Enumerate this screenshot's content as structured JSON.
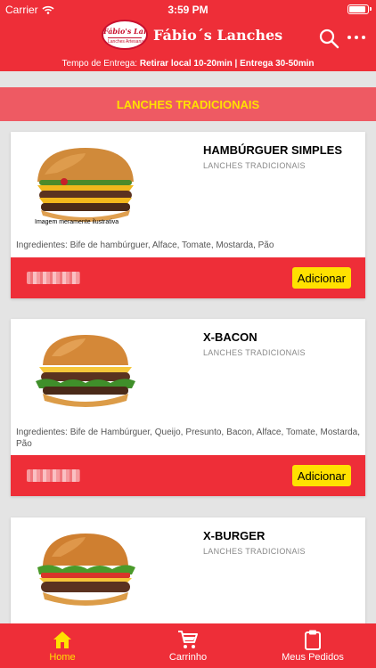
{
  "status_bar": {
    "carrier": "Carrier",
    "time": "3:59 PM",
    "battery_level": 0.95
  },
  "header": {
    "logo_line1": "Fábio's Lanches",
    "logo_line2": "Lanches Artesanais",
    "brand_name": "Fábio´s Lanches",
    "delivery_prefix": "Tempo de Entrega: ",
    "delivery_info": "Retirar local 10-20min | Entrega 30-50min"
  },
  "category_title": "LANCHES TRADICIONAIS",
  "products": [
    {
      "name": "HAMBÚRGUER SIMPLES",
      "category": "LANCHES TRADICIONAIS",
      "image_caption": "Imagem meramente ilustrativa",
      "ingredients": "Ingredientes: Bife de hambúrguer, Alface, Tomate, Mostarda, Pão",
      "add_label": "Adicionar"
    },
    {
      "name": "X-BACON",
      "category": "LANCHES TRADICIONAIS",
      "ingredients": "Ingredientes: Bife de Hambúrguer, Queijo, Presunto, Bacon, Alface, Tomate, Mostarda, Pão",
      "add_label": "Adicionar"
    },
    {
      "name": "X-BURGER",
      "category": "LANCHES TRADICIONAIS"
    }
  ],
  "tabbar": {
    "items": [
      {
        "label": "Home",
        "icon": "home-icon",
        "active": true
      },
      {
        "label": "Carrinho",
        "icon": "cart-icon",
        "active": false
      },
      {
        "label": "Meus Pedidos",
        "icon": "clipboard-icon",
        "active": false
      }
    ]
  },
  "colors": {
    "brand_red": "#ee2e38",
    "accent_yellow": "#ffe100",
    "category_bg": "#ee5a63"
  }
}
